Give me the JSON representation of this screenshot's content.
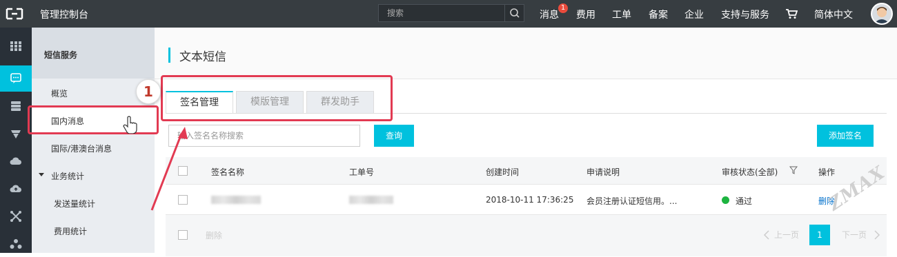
{
  "topbar": {
    "title": "管理控制台",
    "search_placeholder": "搜索",
    "nav": [
      "消息",
      "费用",
      "工单",
      "备案",
      "企业",
      "支持与服务",
      "简体中文"
    ],
    "message_badge": "1"
  },
  "iconbar": {
    "icons": [
      "grid-icon",
      "sms-icon",
      "database-icon",
      "shield-icon",
      "cloud-icon",
      "cloud-upload-icon",
      "network-icon",
      "cluster-icon"
    ],
    "active_index": 1
  },
  "sidenav": {
    "section_title": "短信服务",
    "items": [
      "概览",
      "国内消息",
      "国际/港澳台消息"
    ],
    "group_title": "业务统计",
    "group_items": [
      "发送量统计",
      "费用统计"
    ],
    "selected": "国内消息"
  },
  "page": {
    "title": "文本短信",
    "tabs": [
      "签名管理",
      "模版管理",
      "群发助手"
    ],
    "active_tab": "签名管理",
    "search_placeholder": "输入签名名称搜索",
    "query_button": "查询",
    "add_button": "添加签名"
  },
  "table": {
    "columns": [
      "签名名称",
      "工单号",
      "创建时间",
      "申请说明",
      "审核状态(全部)",
      "操作"
    ],
    "rows": [
      {
        "created": "2018-10-11 17:36:25",
        "description": "会员注册认证短信用。...",
        "status": "通过",
        "action": "删除"
      }
    ],
    "bulk_delete": "删除"
  },
  "pagination": {
    "prev": "上一页",
    "current": "1",
    "next": "下一页"
  },
  "annotation": {
    "step": "1"
  },
  "watermark": "ZMAX",
  "colors": {
    "accent": "#00c1de",
    "topbar": "#373d41",
    "annotation": "#e23a52",
    "status_ok": "#1db440",
    "link": "#0070cc"
  }
}
